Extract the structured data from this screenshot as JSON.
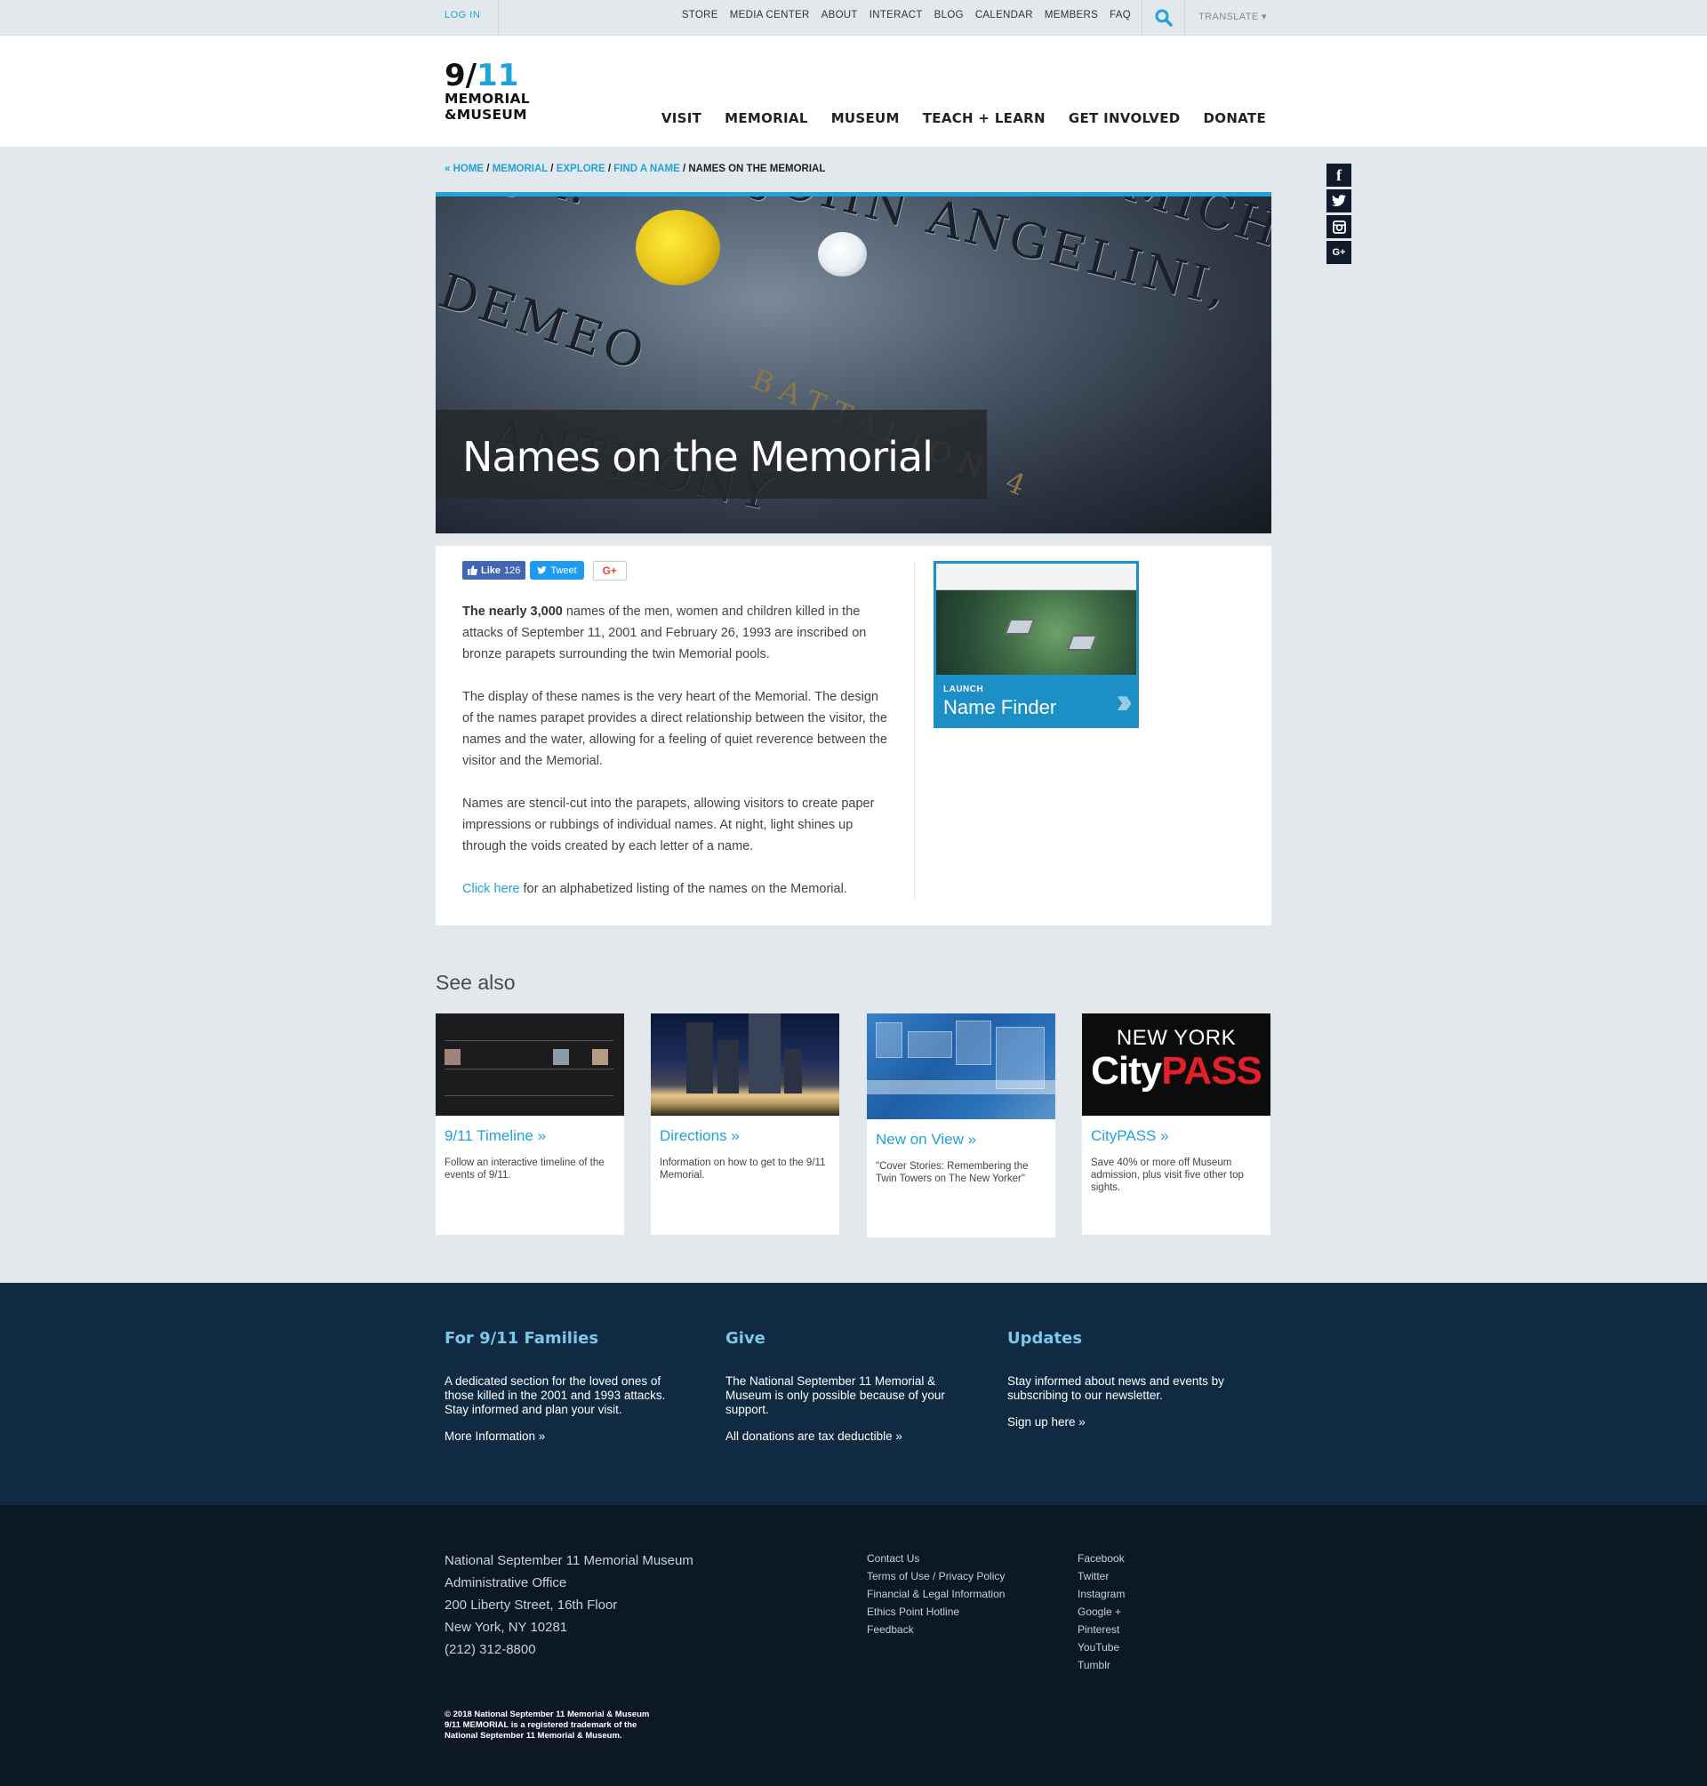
{
  "topbar": {
    "login": "LOG IN",
    "utility_links": [
      "STORE",
      "MEDIA CENTER",
      "ABOUT",
      "INTERACT",
      "BLOG",
      "CALENDAR",
      "MEMBERS",
      "FAQ"
    ],
    "translate": "TRANSLATE ▾"
  },
  "logo": {
    "line1_a": "9/",
    "line1_b": "11",
    "line2": "MEMORIAL",
    "line3": "&MUSEUM"
  },
  "main_nav": [
    "VISIT",
    "MEMORIAL",
    "MUSEUM",
    "TEACH + LEARN",
    "GET INVOLVED",
    "DONATE"
  ],
  "breadcrumb": {
    "items": [
      "« HOME",
      "MEMORIAL",
      "EXPLORE",
      "FIND A NAME"
    ],
    "current": "NAMES ON THE MEMORIAL"
  },
  "social_side": [
    "f",
    "t",
    "ig",
    "G+"
  ],
  "hero": {
    "title": "Names on the Memorial",
    "engraved_1": "JOSEPH JOHN ANGELINI, JR.",
    "engraved_2": "DEMEO",
    "engraved_3": "MICHAEL",
    "engraved_4": "BATTALION 4",
    "engraved_5": "ANTHONY"
  },
  "share": {
    "like_label": "Like",
    "like_count": "126",
    "tweet_label": "Tweet",
    "gplus_label": "G+"
  },
  "article": {
    "p1_bold": "The nearly 3,000",
    "p1_rest": " names of the men, women and children killed in the attacks of September 11, 2001 and February 26, 1993 are inscribed on bronze parapets surrounding the twin Memorial pools.",
    "p2": "The display of these names is the very heart of the Memorial. The design of the names parapet provides a direct relationship between the visitor, the names and the water, allowing for a feeling of quiet reverence between the visitor and the Memorial.",
    "p3": "Names are stencil-cut into the parapets, allowing visitors to create paper impressions or rubbings of individual names. At night, light shines up through the voids created by each letter of a name.",
    "p4_link": "Click here",
    "p4_rest": " for an alphabetized listing of the names on the Memorial."
  },
  "name_finder": {
    "launch": "LAUNCH",
    "label": "Name Finder"
  },
  "see_also": {
    "title": "See also",
    "cards": [
      {
        "title": "9/11 Timeline »",
        "desc": "Follow an interactive timeline of the events of 9/11."
      },
      {
        "title": "Directions »",
        "desc": "Information on how to get to the 9/11 Memorial."
      },
      {
        "title": "New on View »",
        "desc": "\"Cover Stories: Remembering the Twin Towers on The New Yorker\""
      },
      {
        "title": "CityPASS »",
        "desc": "Save 40% or more off Museum admission, plus visit five other top sights."
      }
    ],
    "citypass_ny": "NEW YORK",
    "citypass_city": "City",
    "citypass_pass": "PASS"
  },
  "footer_top": {
    "families": {
      "title": "For 9/11 Families",
      "text": "A dedicated section for the loved ones of those killed in the 2001 and 1993 attacks. Stay informed and plan your visit.",
      "link": "More Information »"
    },
    "give": {
      "title": "Give",
      "text": "The National September 11 Memorial & Museum is only possible because of your support.",
      "link": "All donations are tax deductible »"
    },
    "updates": {
      "title": "Updates",
      "text": "Stay informed about news and events by subscribing to our newsletter.",
      "link": "Sign up here »"
    }
  },
  "footer_bottom": {
    "address": [
      "National September 11 Memorial Museum",
      "Administrative Office",
      "200 Liberty Street, 16th Floor",
      "New York, NY 10281",
      "(212) 312-8800"
    ],
    "links1": [
      "Contact Us",
      "Terms of Use / Privacy Policy",
      "Financial & Legal Information",
      "Ethics Point Hotline",
      "Feedback"
    ],
    "links2": [
      "Facebook",
      "Twitter",
      "Instagram",
      "Google +",
      "Pinterest",
      "YouTube",
      "Tumblr"
    ],
    "copyright": [
      "© 2018 National September 11 Memorial & Museum",
      "9/11 MEMORIAL is a registered trademark of the",
      "National September 11 Memorial & Museum."
    ]
  },
  "colors": {
    "accent": "#1fa3d8",
    "footer_top_bg": "#102a41",
    "footer_bottom_bg": "#0c1826",
    "page_bg": "#e2e8eb"
  }
}
